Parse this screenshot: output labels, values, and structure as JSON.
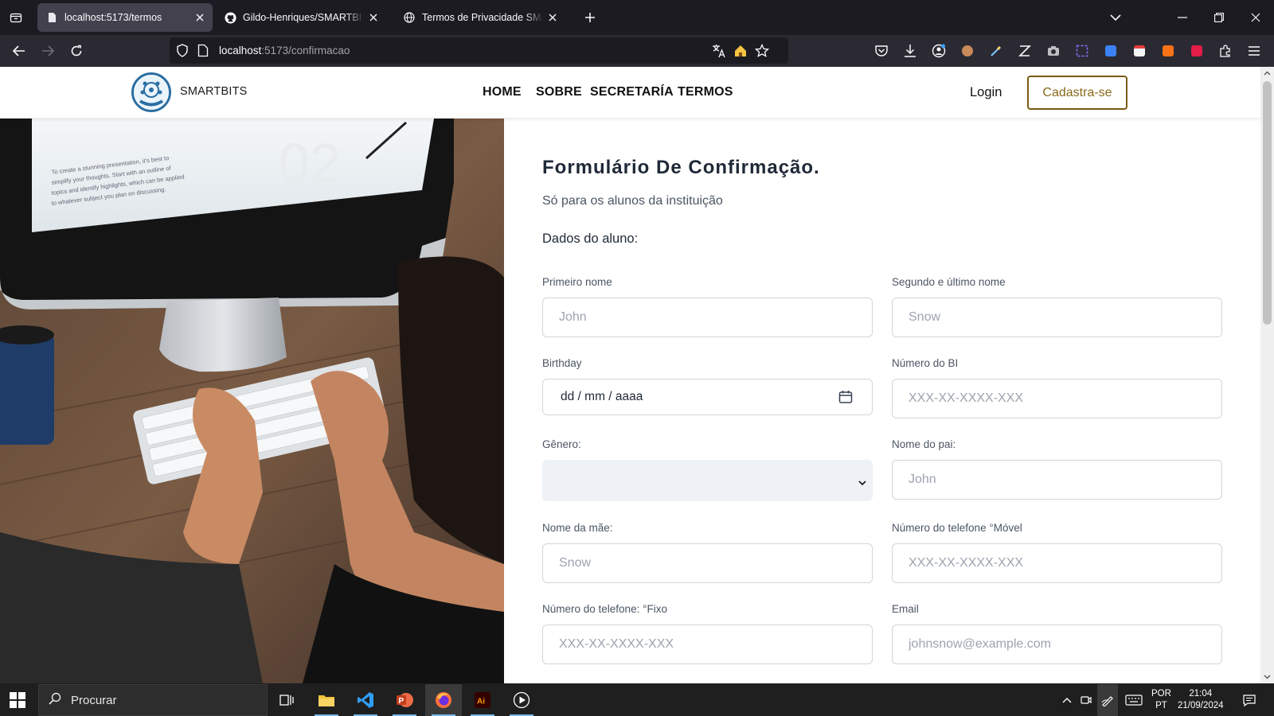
{
  "browser": {
    "tabs": [
      {
        "title": "localhost:5173/termos",
        "active": true
      },
      {
        "title": "Gildo-Henriques/SMARTBITS: Pr",
        "active": false
      },
      {
        "title": "Termos de Privacidade SMARTBI",
        "active": false
      }
    ],
    "url": {
      "host": "localhost",
      "rest": ":5173/confirmacao"
    }
  },
  "site": {
    "brand": "SMARTBITS",
    "nav": [
      "HOME",
      "SOBRE",
      "SECRETARÍA",
      "TERMOS"
    ],
    "login": "Login",
    "signup": "Cadastra-se"
  },
  "photo": {
    "screen_text": [
      "To create a stunning presentation, it's best to",
      "simplify your thoughts. Start with an outline of",
      "topics and identify highlights, which can be applied",
      "to whatever subject you plan on discussing."
    ],
    "screen_number": "02"
  },
  "form": {
    "title": "Formulário De Confirmação.",
    "subtitle": "Só para os alunos da instituição",
    "section": "Dados do aluno:",
    "fields": {
      "first_name": {
        "label": "Primeiro nome",
        "placeholder": "John"
      },
      "last_name": {
        "label": "Segundo e último nome",
        "placeholder": "Snow"
      },
      "birthday": {
        "label": "Birthday",
        "value": "dd / mm / aaaa"
      },
      "bi": {
        "label": "Número do BI",
        "placeholder": "XXX-XX-XXXX-XXX"
      },
      "gender": {
        "label": "Gênero:",
        "value": ""
      },
      "father": {
        "label": "Nome do pai:",
        "placeholder": "John"
      },
      "mother": {
        "label": "Nome da mãe:",
        "placeholder": "Snow"
      },
      "mobile": {
        "label": "Número do telefone °Móvel",
        "placeholder": "XXX-XX-XXXX-XXX"
      },
      "landline": {
        "label": "Número do telefone: °Fixo",
        "placeholder": "XXX-XX-XXXX-XXX"
      },
      "email": {
        "label": "Email",
        "placeholder": "johnsnow@example.com"
      }
    }
  },
  "taskbar": {
    "search_placeholder": "Procurar",
    "lang": [
      "POR",
      "PT"
    ],
    "time": "21:04",
    "date": "21/09/2024"
  },
  "colors": {
    "accent_button": "#8a6a1a",
    "browser_bg": "#1c1b22",
    "field_border": "#d1d5db"
  }
}
